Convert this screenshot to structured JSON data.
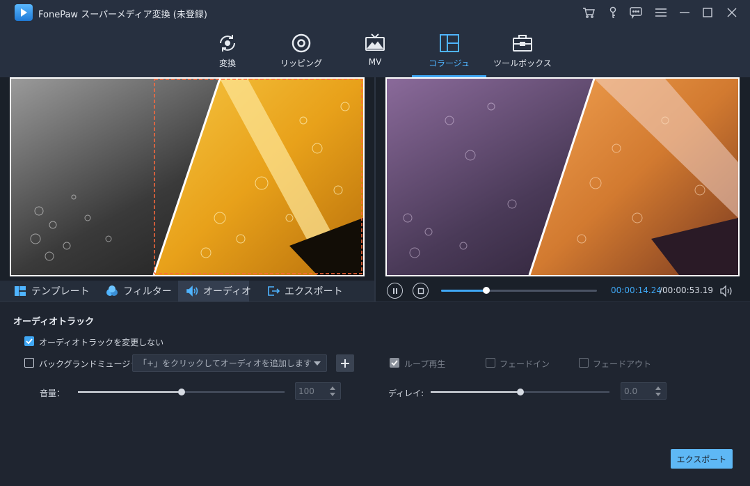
{
  "app": {
    "title": "FonePaw スーパーメディア変換 (未登録)"
  },
  "nav": {
    "items": [
      {
        "label": "変換",
        "icon": "convert-icon"
      },
      {
        "label": "リッピング",
        "icon": "disc-icon"
      },
      {
        "label": "MV",
        "icon": "tv-icon"
      },
      {
        "label": "コラージュ",
        "icon": "collage-icon",
        "active": true
      },
      {
        "label": "ツールボックス",
        "icon": "toolbox-icon"
      }
    ]
  },
  "left_tabs": [
    {
      "label": "テンプレート",
      "icon": "template-icon"
    },
    {
      "label": "フィルター",
      "icon": "filter-icon"
    },
    {
      "label": "オーディオ",
      "icon": "audio-icon",
      "active": true
    },
    {
      "label": "エクスポート",
      "icon": "export-icon"
    }
  ],
  "player": {
    "current_time": "00:00:14.24",
    "total_time": "/00:00:53.19",
    "progress": 0.29
  },
  "audio": {
    "section_title": "オーディオトラック",
    "keep_track_label": "オーディオトラックを変更しない",
    "keep_track_checked": true,
    "bgm_label": "バックグランドミュージック",
    "bgm_checked": false,
    "bgm_placeholder": "「+」をクリックしてオーディオを追加します",
    "loop_label": "ループ再生",
    "loop_checked": true,
    "fadein_label": "フェードイン",
    "fadeout_label": "フェードアウト",
    "volume_label": "音量：",
    "volume_value": "100",
    "volume_level": 0.5,
    "delay_label": "ディレイ:",
    "delay_value": "0.0",
    "delay_level": 0.5
  },
  "export_button": "エクスポート",
  "colors": {
    "accent": "#3fa7f4",
    "bg": "#1f2530",
    "bar": "#273040"
  }
}
